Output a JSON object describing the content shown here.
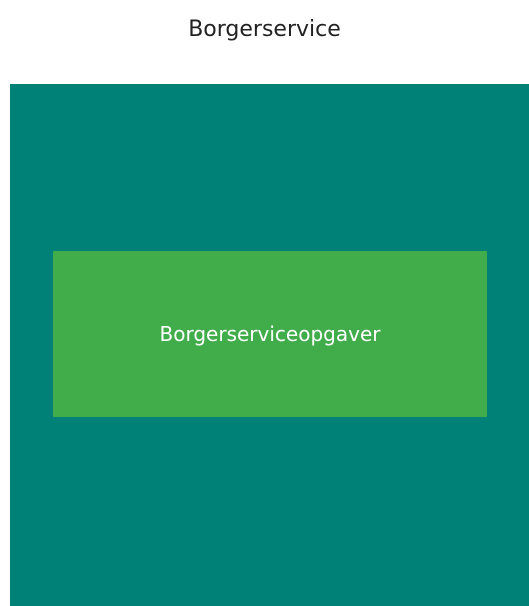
{
  "diagram": {
    "title": "Borgerservice",
    "outer": {
      "color": "#008177"
    },
    "inner": {
      "label": "Borgerserviceopgaver",
      "color": "#40AD4A"
    }
  }
}
